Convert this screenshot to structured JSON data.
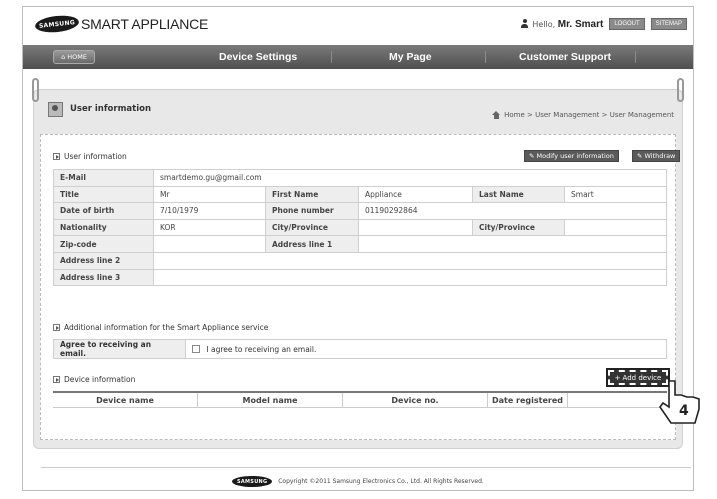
{
  "header": {
    "brand_badge": "SAMSUNG",
    "brand_title": "SMART APPLIANCE",
    "greeting": "Hello,",
    "user_name": "Mr. Smart",
    "logout_label": "LOGOUT",
    "sitemap_label": "SITEMAP"
  },
  "nav": {
    "home_label": "HOME",
    "items": [
      "Device Settings",
      "My Page",
      "Customer Support"
    ]
  },
  "page": {
    "title": "User information",
    "breadcrumb": "Home > User Management > User Management"
  },
  "user_info": {
    "section_title": "User information",
    "modify_label": "Modify user information",
    "withdraw_label": "Withdraw",
    "email_label": "E-Mail",
    "email_value": "smartdemo.gu@gmail.com",
    "title_label": "Title",
    "title_value": "Mr",
    "first_name_label": "First Name",
    "first_name_value": "Appliance",
    "last_name_label": "Last Name",
    "last_name_value": "Smart",
    "dob_label": "Date of birth",
    "dob_value": "7/10/1979",
    "phone_label": "Phone number",
    "phone_value": "01190292864",
    "nationality_label": "Nationality",
    "nationality_value": "KOR",
    "city_label": "City/Province",
    "city_value": "",
    "city2_label": "City/Province",
    "city2_value": "",
    "zip_label": "Zip-code",
    "zip_value": "",
    "addr1_label": "Address line 1",
    "addr1_value": "",
    "addr2_label": "Address line 2",
    "addr2_value": "",
    "addr3_label": "Address line 3",
    "addr3_value": ""
  },
  "additional": {
    "section_title": "Additional information for the Smart Appliance service",
    "agree_label": "Agree to receiving an email.",
    "agree_checkbox_label": "I agree to receiving an email."
  },
  "devices": {
    "section_title": "Device information",
    "add_label": "Add device",
    "columns": [
      "Device name",
      "Model name",
      "Device no.",
      "Date registered",
      ""
    ]
  },
  "annotation": {
    "step_number": "4"
  },
  "footer": {
    "badge": "SAMSUNG",
    "copyright": "Copyright ©2011 Samsung Electronics Co., Ltd. All Rights Reserved."
  },
  "colors": {
    "nav_bg": "#5f5f5f",
    "panel_bg": "#e8e8e8",
    "label_bg": "#eeeeee"
  }
}
